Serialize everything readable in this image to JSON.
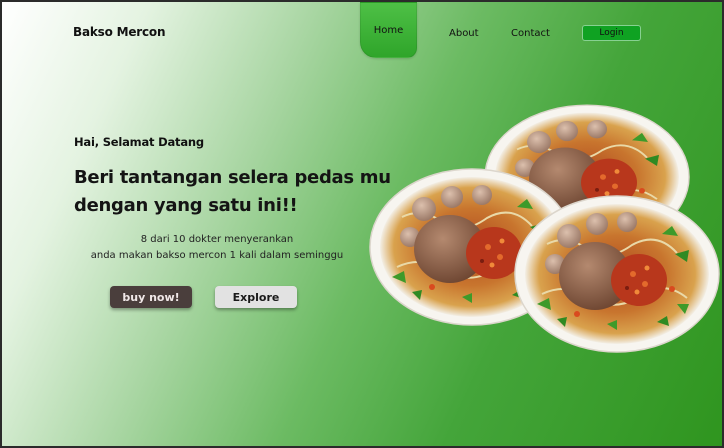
{
  "nav": {
    "brand": "Bakso Mercon",
    "home": "Home",
    "about": "About",
    "contact": "Contact",
    "login": "Login"
  },
  "hero": {
    "greeting": "Hai, Selamat Datang",
    "headline_line1": "Beri tantangan selera pedas mu",
    "headline_line2": "dengan yang satu ini!!",
    "sub_line1": "8 dari 10 dokter menyerankan",
    "sub_line2": "anda makan bakso mercon 1 kali dalam seminggu",
    "buy_button": "buy now!",
    "explore_button": "Explore"
  },
  "image": {
    "subject": "bakso-mercon-bowls-illustration",
    "count": 3
  },
  "colors": {
    "accent_green": "#0fa222",
    "nav_home_green": "#3bb234",
    "buy_button_bg": "#4a3e3c",
    "explore_button_bg": "#e2e2e2"
  }
}
